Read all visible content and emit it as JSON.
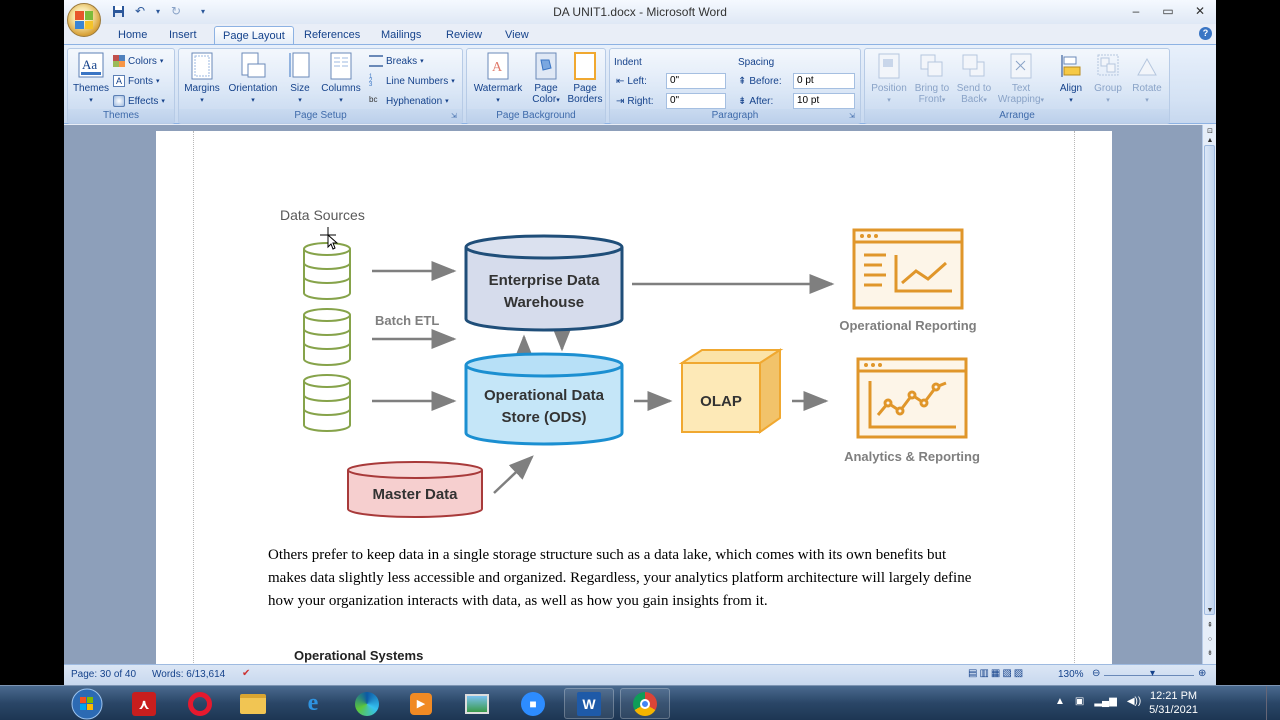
{
  "window": {
    "title": "DA UNIT1.docx - Microsoft Word"
  },
  "qat": {
    "undo_glyph": "↶",
    "redo_glyph": "↻",
    "more_glyph": "▾"
  },
  "window_controls": {
    "minimize": "–",
    "maximize": "▭",
    "close": "✕"
  },
  "tabs": [
    "Home",
    "Insert",
    "Page Layout",
    "References",
    "Mailings",
    "Review",
    "View"
  ],
  "active_tab": "Page Layout",
  "ribbon": {
    "themes": {
      "themes_label": "Themes",
      "colors": "Colors",
      "fonts": "Fonts",
      "effects": "Effects",
      "group": "Themes"
    },
    "page_setup": {
      "margins": "Margins",
      "orientation": "Orientation",
      "size": "Size",
      "columns": "Columns",
      "breaks": "Breaks",
      "line_numbers": "Line Numbers",
      "hyphenation": "Hyphenation",
      "group": "Page Setup"
    },
    "page_background": {
      "watermark": "Watermark",
      "page_color_1": "Page",
      "page_color_2": "Color",
      "page_borders_1": "Page",
      "page_borders_2": "Borders",
      "group": "Page Background"
    },
    "paragraph": {
      "indent": "Indent",
      "left_label": "Left:",
      "left_value": "0\"",
      "right_label": "Right:",
      "right_value": "0\"",
      "spacing": "Spacing",
      "before_label": "Before:",
      "before_value": "0 pt",
      "after_label": "After:",
      "after_value": "10 pt",
      "group": "Paragraph"
    },
    "arrange": {
      "position": "Position",
      "bring_front_1": "Bring to",
      "bring_front_2": "Front",
      "send_back_1": "Send to",
      "send_back_2": "Back",
      "text_wrapping_1": "Text",
      "text_wrapping_2": "Wrapping",
      "align": "Align",
      "group_btn": "Group",
      "rotate": "Rotate",
      "group": "Arrange"
    }
  },
  "diagram": {
    "data_sources": "Data Sources",
    "batch_etl": "Batch ETL",
    "edw_line1": "Enterprise Data",
    "edw_line2": "Warehouse",
    "ods_line1": "Operational Data",
    "ods_line2": "Store (ODS)",
    "olap": "OLAP",
    "master_data": "Master Data",
    "operational_reporting": "Operational Reporting",
    "analytics_reporting": "Analytics & Reporting",
    "colors": {
      "source": "#86a34a",
      "edw": "#1f4e79",
      "ods": "#1b8fd1",
      "olap": "#f0a830",
      "master": "#a83a3a",
      "report": "#e0962a",
      "arrow": "#7f7f7f"
    }
  },
  "document": {
    "paragraph": "Others prefer to keep data in a single storage structure such as a data lake, which comes with its own benefits but makes data slightly less accessible and organized. Regardless, your analytics platform architecture will largely define how your organization interacts with data, as well as how you gain insights from it.",
    "next_heading": "Operational Systems"
  },
  "status": {
    "page": "Page: 30 of 40",
    "words": "Words: 6/13,614",
    "zoom": "130%"
  },
  "taskbar": {
    "time": "12:21 PM",
    "date": "5/31/2021"
  }
}
